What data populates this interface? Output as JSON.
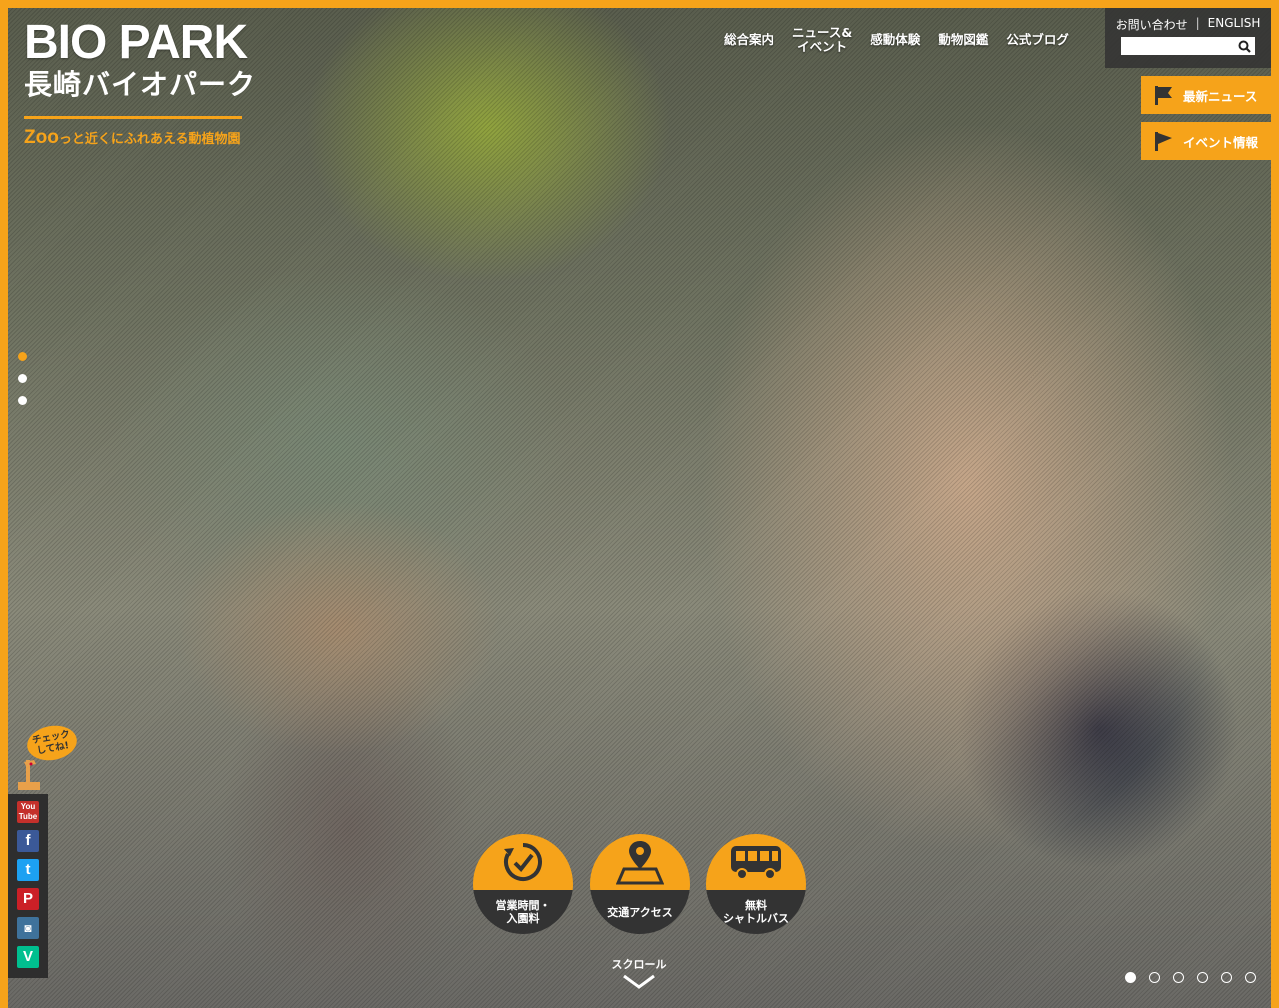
{
  "site": {
    "logo_en": "BIO PARK",
    "logo_jp": "長崎バイオパーク",
    "tagline_zoo": "Zoo",
    "tagline_rest": "っと近くにふれあえる動植物園"
  },
  "nav": {
    "items": [
      {
        "label": "総合案内"
      },
      {
        "label": "ニュース&\nイベント"
      },
      {
        "label": "感動体験"
      },
      {
        "label": "動物図鑑"
      },
      {
        "label": "公式ブログ"
      }
    ]
  },
  "utility": {
    "contact": "お問い合わせ",
    "separator": "|",
    "english": "ENGLISH",
    "search_placeholder": ""
  },
  "side_buttons": {
    "news": "最新ニュース",
    "events": "イベント情報"
  },
  "social": {
    "bubble": "チェック\nしてね!",
    "icons": [
      "youtube-icon",
      "facebook-icon",
      "twitter-icon",
      "pinterest-icon",
      "instagram-icon",
      "vine-icon"
    ]
  },
  "quick_links": {
    "hours": "営業時間・\n入園料",
    "access": "交通アクセス",
    "shuttle": "無料\nシャトルバス"
  },
  "scroll_label": "スクロール",
  "colors": {
    "accent": "#f6a31a",
    "dark": "#333333"
  }
}
